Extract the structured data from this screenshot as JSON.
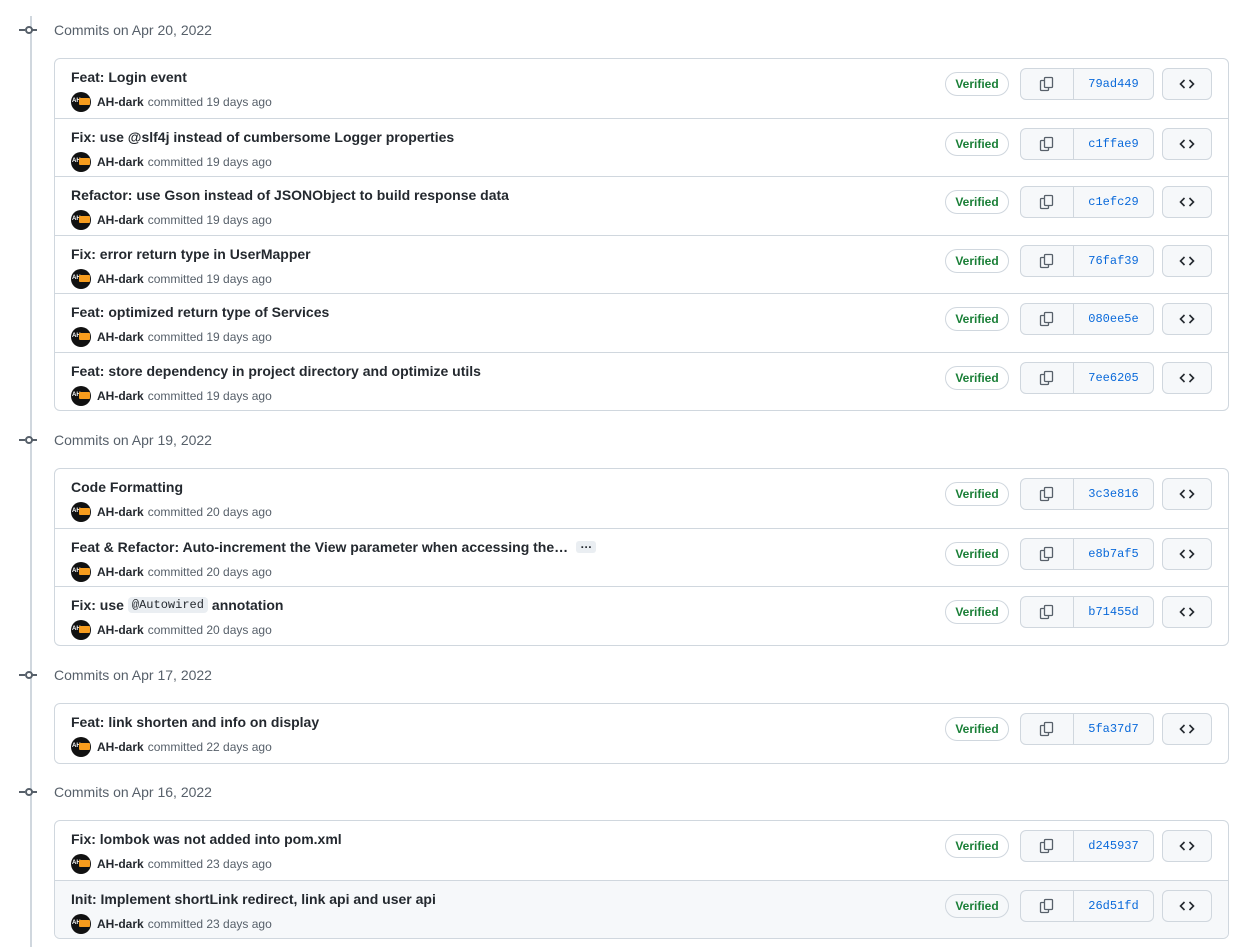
{
  "groups": [
    {
      "date_label": "Commits on Apr 20, 2022",
      "commits": [
        {
          "title": "Feat: Login event",
          "author": "AH-dark",
          "time": "committed 19 days ago",
          "sha": "79ad449",
          "verified": "Verified"
        },
        {
          "title": "Fix: use @slf4j instead of cumbersome Logger properties",
          "author": "AH-dark",
          "time": "committed 19 days ago",
          "sha": "c1ffae9",
          "verified": "Verified"
        },
        {
          "title": "Refactor: use Gson instead of JSONObject to build response data",
          "author": "AH-dark",
          "time": "committed 19 days ago",
          "sha": "c1efc29",
          "verified": "Verified"
        },
        {
          "title": "Fix: error return type in UserMapper",
          "author": "AH-dark",
          "time": "committed 19 days ago",
          "sha": "76faf39",
          "verified": "Verified"
        },
        {
          "title": "Feat: optimized return type of Services",
          "author": "AH-dark",
          "time": "committed 19 days ago",
          "sha": "080ee5e",
          "verified": "Verified"
        },
        {
          "title": "Feat: store dependency in project directory and optimize utils",
          "author": "AH-dark",
          "time": "committed 19 days ago",
          "sha": "7ee6205",
          "verified": "Verified"
        }
      ]
    },
    {
      "date_label": "Commits on Apr 19, 2022",
      "commits": [
        {
          "title": "Code Formatting",
          "author": "AH-dark",
          "time": "committed 20 days ago",
          "sha": "3c3e816",
          "verified": "Verified"
        },
        {
          "title": "Feat & Refactor: Auto-increment the View parameter when accessing the…",
          "author": "AH-dark",
          "time": "committed 20 days ago",
          "sha": "e8b7af5",
          "verified": "Verified",
          "expand": "…"
        },
        {
          "title_pre": "Fix: use",
          "title_code": "@Autowired",
          "title_post": "annotation",
          "author": "AH-dark",
          "time": "committed 20 days ago",
          "sha": "b71455d",
          "verified": "Verified"
        }
      ]
    },
    {
      "date_label": "Commits on Apr 17, 2022",
      "commits": [
        {
          "title": "Feat: link shorten and info on display",
          "author": "AH-dark",
          "time": "committed 22 days ago",
          "sha": "5fa37d7",
          "verified": "Verified"
        }
      ]
    },
    {
      "date_label": "Commits on Apr 16, 2022",
      "commits": [
        {
          "title": "Fix: lombok was not added into pom.xml",
          "author": "AH-dark",
          "time": "committed 23 days ago",
          "sha": "d245937",
          "verified": "Verified"
        },
        {
          "title": "Init: Implement shortLink redirect, link api and user api",
          "author": "AH-dark",
          "time": "committed 23 days ago",
          "sha": "26d51fd",
          "verified": "Verified",
          "highlighted": true
        }
      ]
    }
  ],
  "icons": {
    "timeline_marker": "git-commit-icon",
    "copy": "copy-icon",
    "browse": "code-icon",
    "avatar": "avatar"
  },
  "colors": {
    "verified": "#1a7f37",
    "sha_link": "#0969da",
    "border": "#d0d7de",
    "row_hover": "#f6f8fa"
  }
}
